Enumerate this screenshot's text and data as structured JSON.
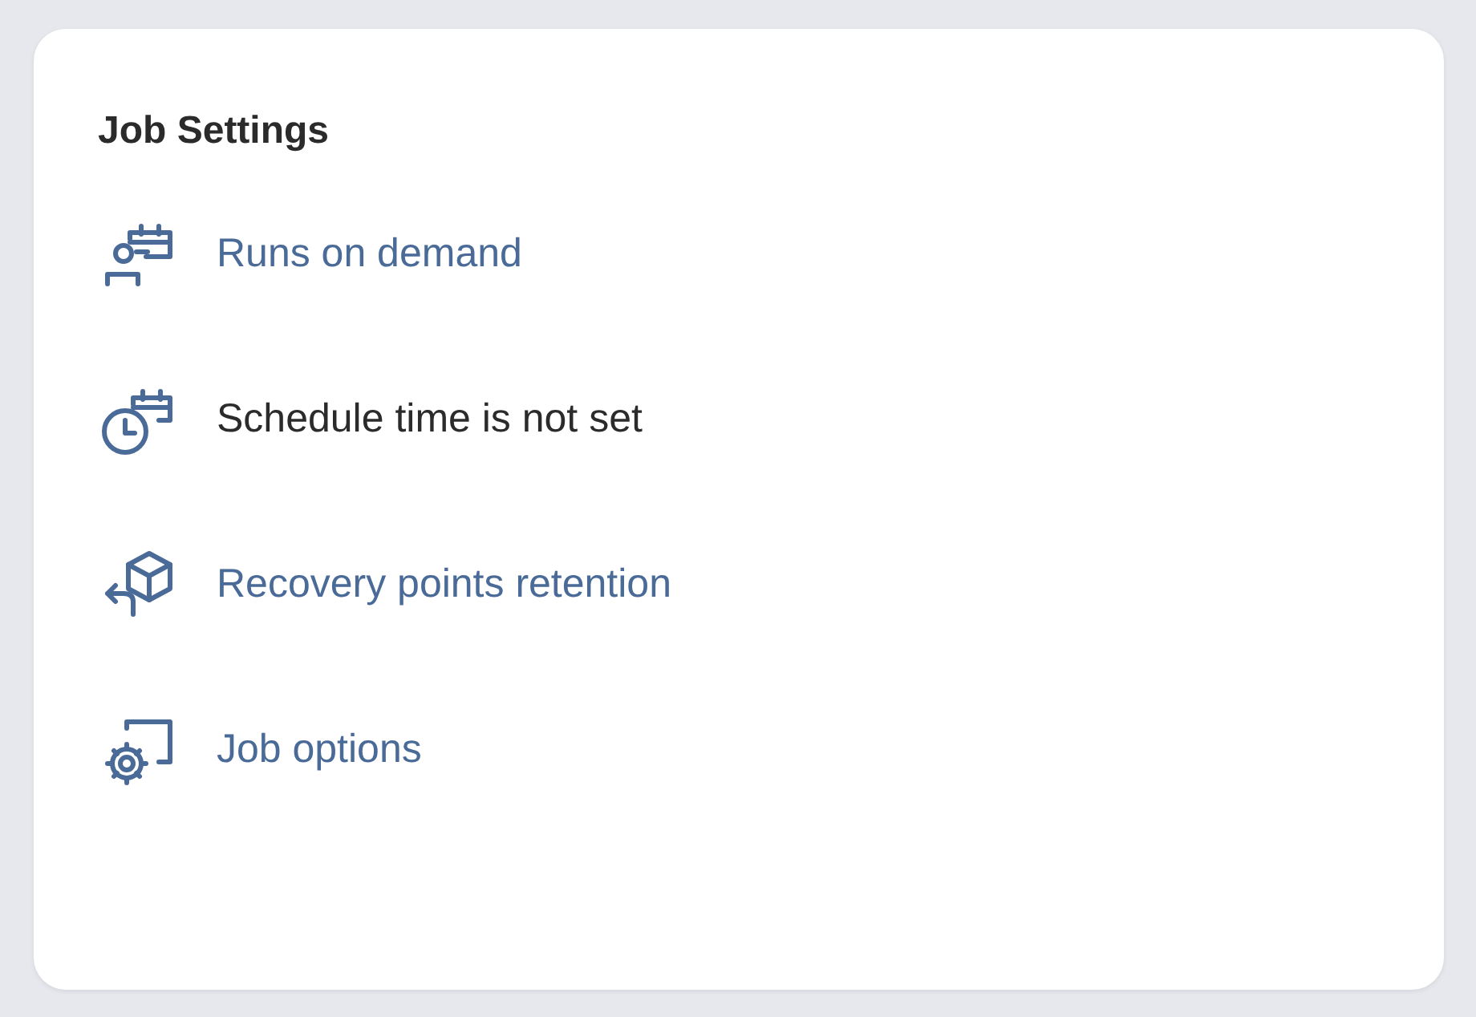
{
  "card": {
    "title": "Job Settings",
    "items": [
      {
        "kind": "link",
        "label": "Runs on demand"
      },
      {
        "kind": "text",
        "label": "Schedule time is not set"
      },
      {
        "kind": "link",
        "label": "Recovery points retention"
      },
      {
        "kind": "link",
        "label": "Job options"
      }
    ]
  }
}
